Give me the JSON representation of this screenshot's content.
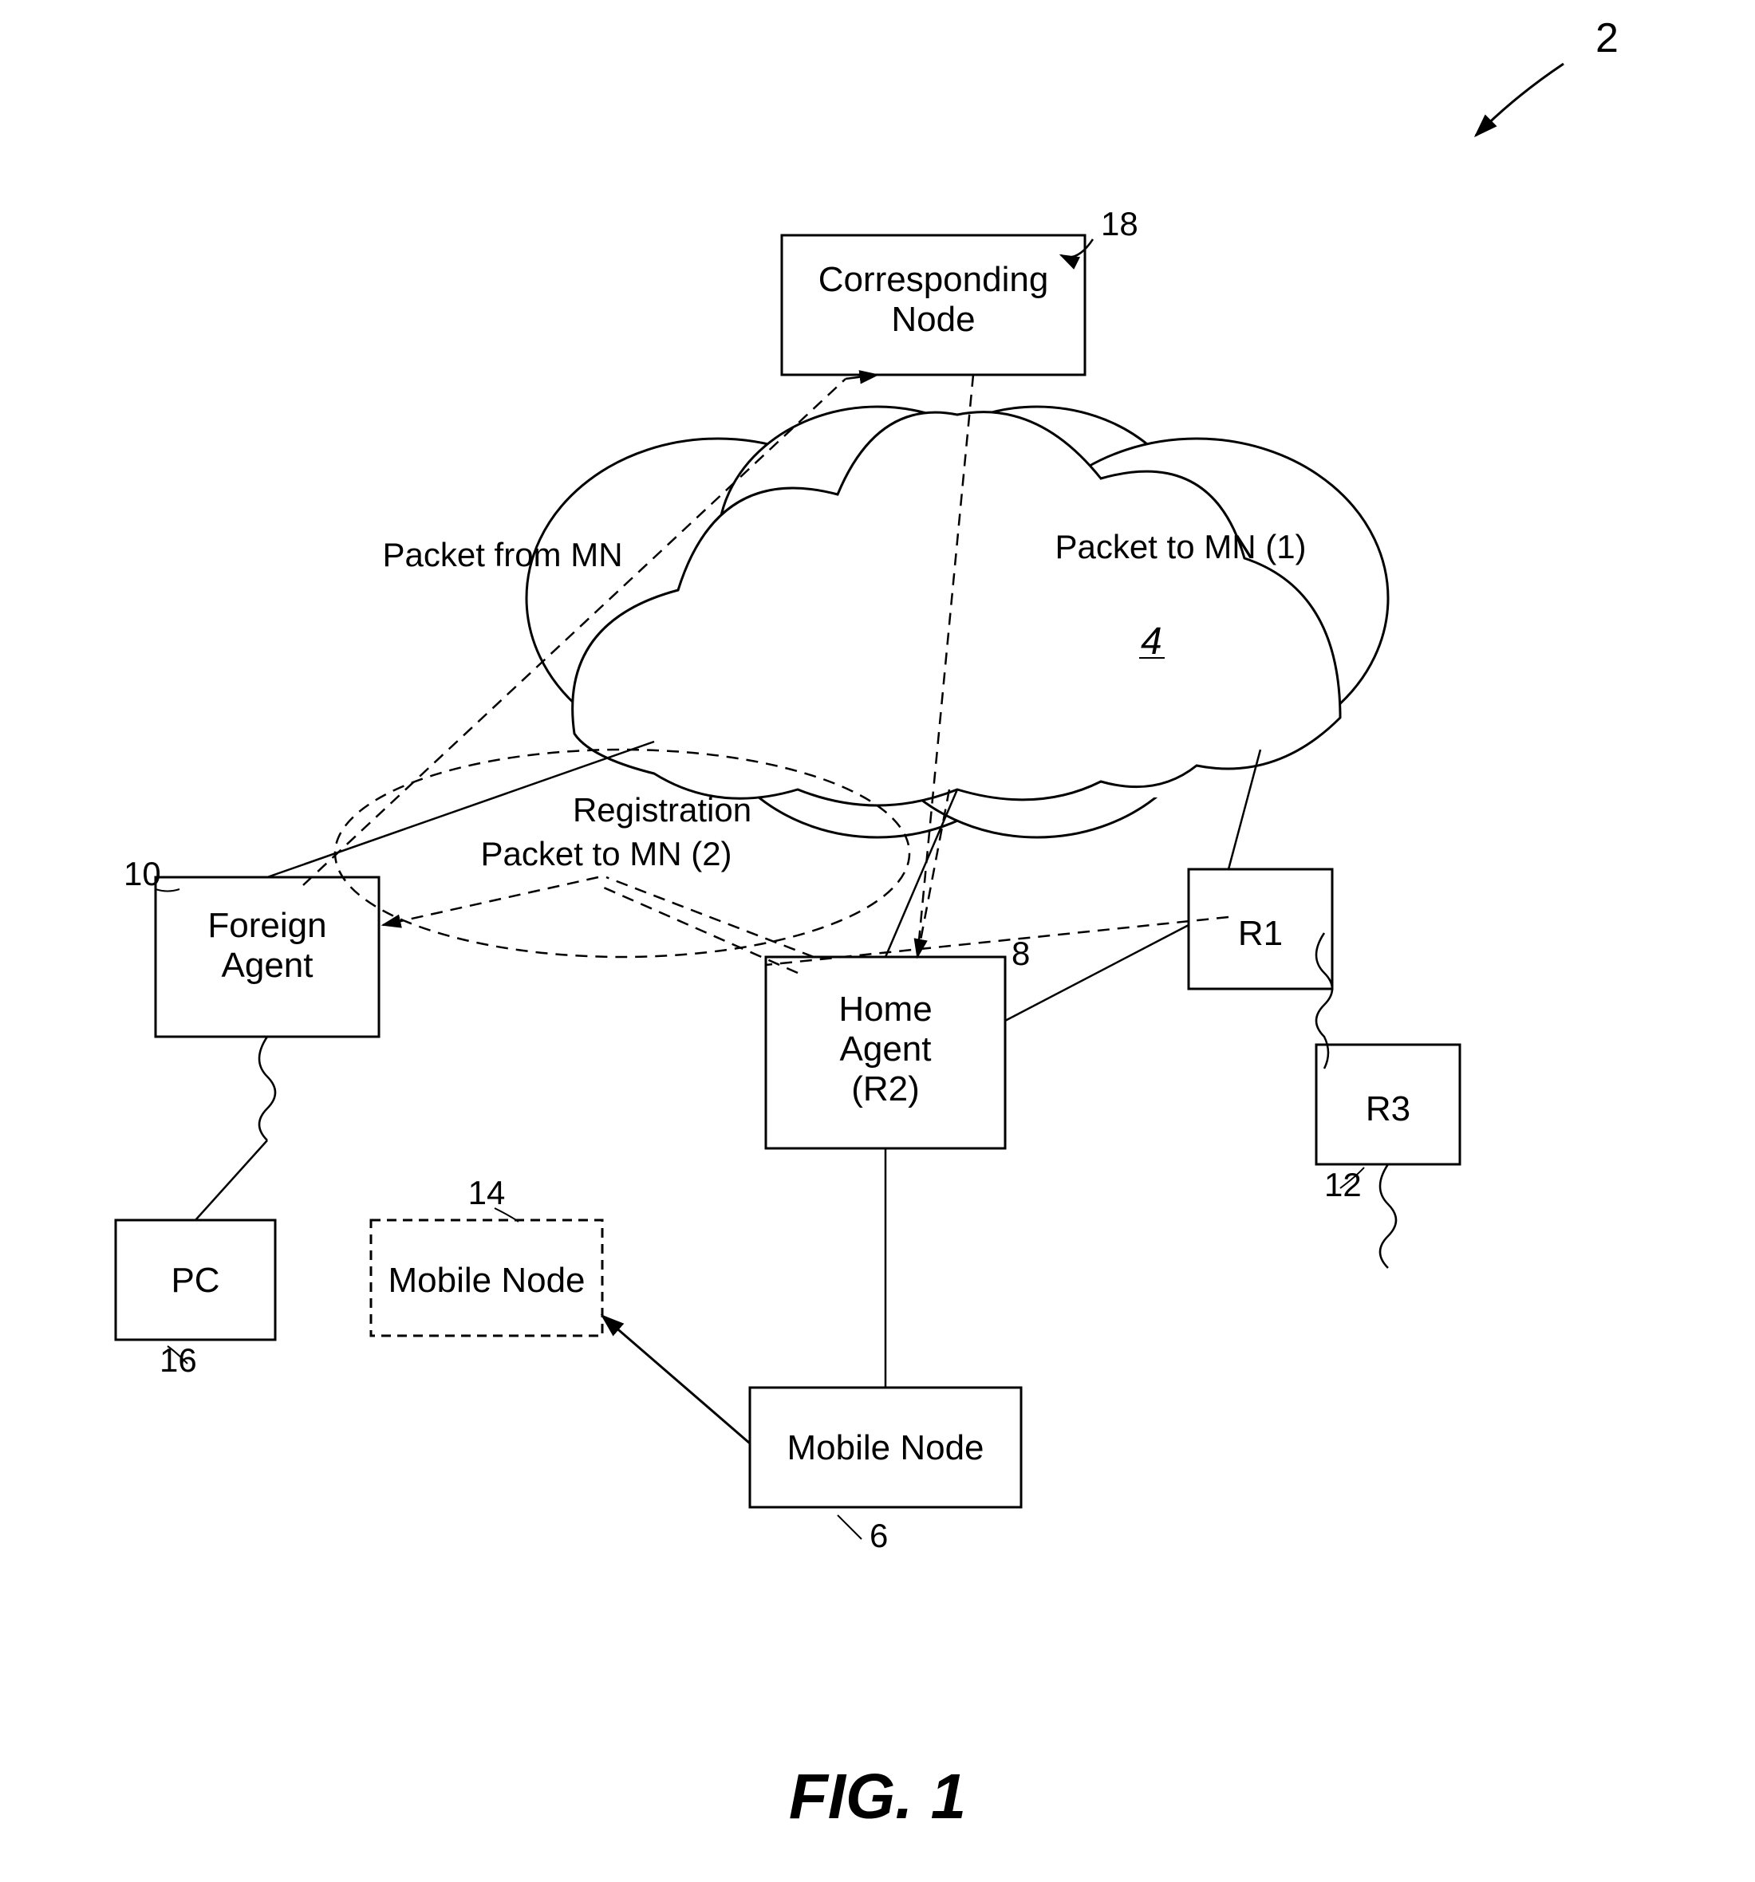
{
  "figure": {
    "title": "FIG. 1",
    "ref": "2"
  },
  "nodes": {
    "corresponding_node": {
      "label": "Corresponding\nNode",
      "ref": "18"
    },
    "foreign_agent": {
      "label": "Foreign\nAgent",
      "ref": "10"
    },
    "home_agent": {
      "label": "Home\nAgent\n(R2)",
      "ref": "8"
    },
    "pc": {
      "label": "PC",
      "ref": "16"
    },
    "mobile_node_dashed": {
      "label": "Mobile Node",
      "ref": "14"
    },
    "mobile_node_solid": {
      "label": "Mobile Node",
      "ref": "6"
    },
    "r1": {
      "label": "R1"
    },
    "r3": {
      "label": "R3",
      "ref": "12"
    }
  },
  "labels": {
    "cloud_label": "4",
    "packet_from_mn": "Packet from MN",
    "packet_to_mn_1": "Packet to MN (1)",
    "registration": "Registration",
    "packet_to_mn_2": "Packet to MN (2)"
  }
}
